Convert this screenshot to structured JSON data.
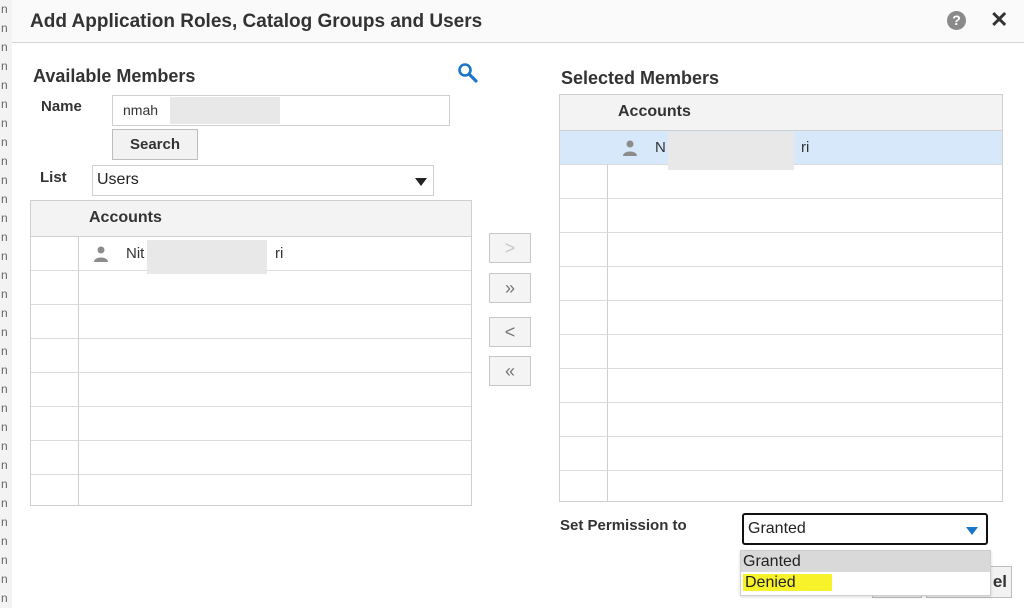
{
  "window": {
    "title": "Add Application Roles, Catalog Groups and Users",
    "help_icon_glyph": "?",
    "close_icon_glyph": "✕"
  },
  "background": {
    "edge_chars": [
      "n",
      "n",
      "n",
      "n",
      "n",
      "n",
      "n",
      "n",
      "n",
      "n",
      "n",
      "n",
      "n",
      "n",
      "n",
      "n",
      "n",
      "n",
      "n",
      "n",
      "n",
      "n",
      "n",
      "n",
      "n",
      "n",
      "n",
      "n",
      "n",
      "n",
      "n",
      "n"
    ]
  },
  "available": {
    "title": "Available Members",
    "name_label": "Name",
    "name_value": "nmah",
    "search_button": "Search",
    "list_label": "List",
    "list_value": "Users",
    "accounts_header": "Accounts",
    "accounts": [
      {
        "prefix": "Nit",
        "suffix": "ri",
        "icon": "user-icon"
      }
    ]
  },
  "move_buttons": {
    "move": ">",
    "move_all": "»",
    "remove": "<",
    "remove_all": "«"
  },
  "selected": {
    "title": "Selected Members",
    "accounts_header": "Accounts",
    "accounts": [
      {
        "prefix": "N",
        "suffix": "ri",
        "icon": "user-icon"
      }
    ]
  },
  "permission": {
    "label": "Set Permission to",
    "value": "Granted",
    "options": [
      "Granted",
      "Denied"
    ],
    "highlighted_option": "Denied"
  },
  "footer": {
    "cancel_partial": "el"
  },
  "colors": {
    "selection_row": "#d6e8f9",
    "highlight": "#f7f22a",
    "link_icon": "#1b76c9"
  }
}
